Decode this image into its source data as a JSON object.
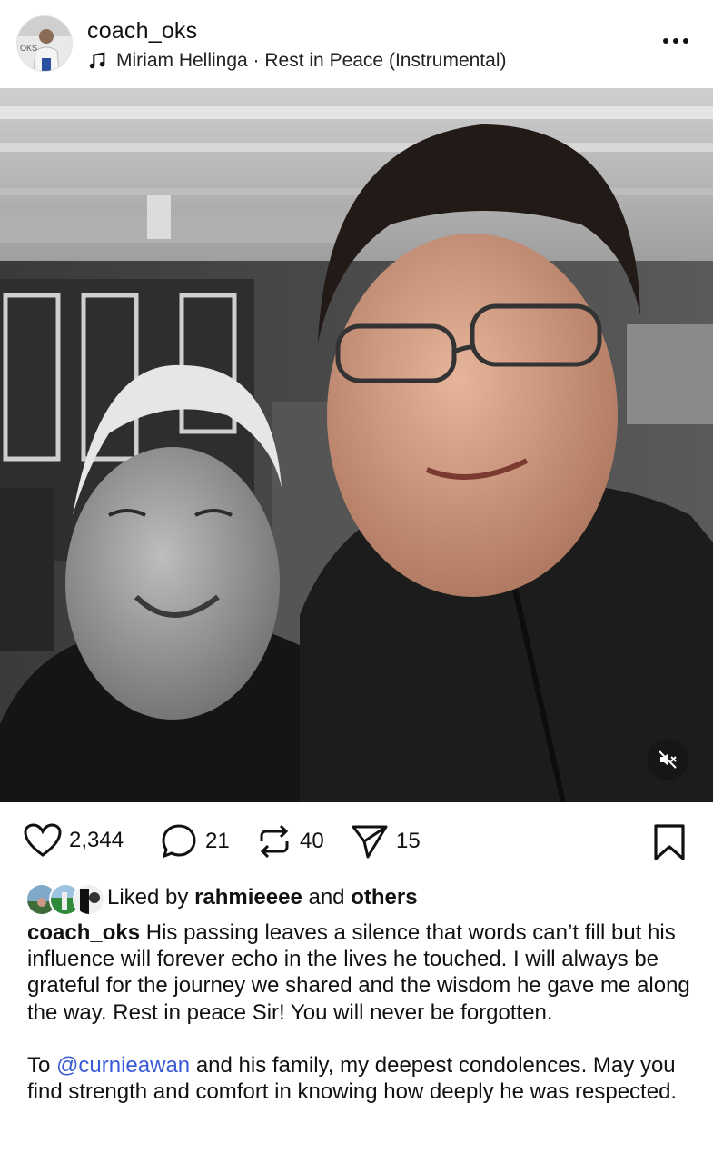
{
  "header": {
    "username": "coach_oks",
    "avatar_label": "OKS",
    "audio_artist": "Miriam Hellinga",
    "audio_separator": " · ",
    "audio_title": "Rest in Peace (Instrumental)"
  },
  "icons": {
    "more": "more-options-icon",
    "music": "music-note-icon",
    "like": "heart-icon",
    "comment": "comment-icon",
    "repost": "repost-icon",
    "share": "send-icon",
    "bookmark": "bookmark-icon",
    "mute": "speaker-muted-icon"
  },
  "actions": {
    "likes": "2,344",
    "comments": "21",
    "reposts": "40",
    "shares": "15"
  },
  "liked_by": {
    "prefix": "Liked by",
    "user": "rahmieeee",
    "conjunction": "and",
    "others": "others"
  },
  "caption": {
    "author": "coach_oks",
    "text": "His passing leaves a silence that words can’t fill but his influence will forever echo in the lives he touched. I will always be grateful for the journey we shared and the wisdom he gave me along the way. Rest in peace Sir! You will never be forgotten.",
    "second_prefix": "To",
    "mention": "@curnieawan",
    "second_text": "and his family, my deepest condolences. May you find strength and comfort in knowing how deeply he was respected."
  },
  "colors": {
    "mention": "#3b5bd6",
    "text": "#111111",
    "background": "#ffffff"
  }
}
